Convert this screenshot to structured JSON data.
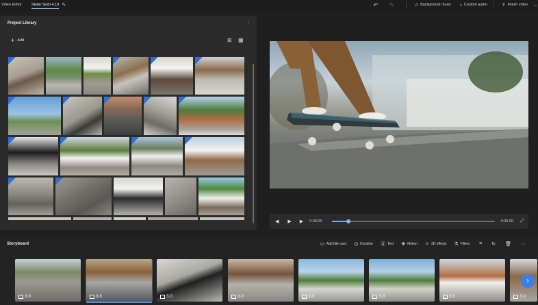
{
  "topbar": {
    "app_title": "Video Editor",
    "project_name": "Skate Sesh 4.19",
    "pencil_icon": "✎",
    "undo_icon": "↶",
    "redo_icon": "↷",
    "background_music": "Background music",
    "custom_audio": "Custom audio",
    "finish_video": "Finish video",
    "more_icon": "···"
  },
  "library": {
    "title": "Project Library",
    "add_label": "Add",
    "more_icon": "⋮"
  },
  "player": {
    "time_current": "0:00.00",
    "time_total": "0:30.00",
    "progress": 0.1
  },
  "storyboard": {
    "title": "Storyboard",
    "tools": {
      "add_title_card": "Add title card",
      "duration": "Duration",
      "text": "Text",
      "motion": "Motion",
      "effects_3d": "3D effects",
      "filters": "Filters"
    },
    "clips": [
      {
        "duration": "3.0"
      },
      {
        "duration": "3.0"
      },
      {
        "duration": "3.0"
      },
      {
        "duration": "3.0"
      },
      {
        "duration": "3.0"
      },
      {
        "duration": "3.0"
      },
      {
        "duration": "3.0"
      },
      {
        "duration": "3.0"
      }
    ]
  }
}
